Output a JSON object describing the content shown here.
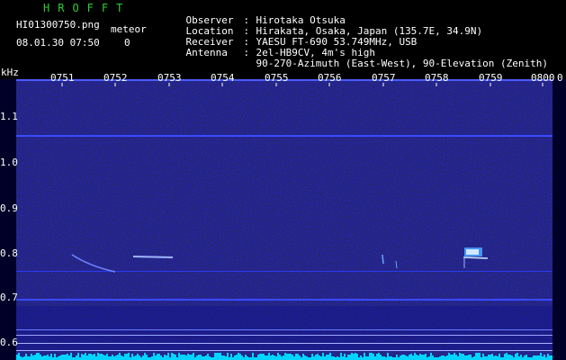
{
  "header": {
    "brand": "HROFFT",
    "filename": "HI01300750.png",
    "meteor_label": "meteor",
    "datetime": "08.01.30 07:50",
    "meteor_count": "0",
    "info": [
      {
        "key": "Observer",
        "value": "Hirotaka Otsuka"
      },
      {
        "key": "Location",
        "value": "Hirakata, Osaka, Japan (135.7E, 34.9N)"
      },
      {
        "key": "Receiver",
        "value": "YAESU FT-690 53.749MHz, USB"
      },
      {
        "key": "Antenna",
        "value": "2el-HB9CV, 4m's high"
      },
      {
        "key": "",
        "value": "90-270-Azimuth (East-West), 90-Elevation (Zenith)"
      }
    ]
  },
  "spectrogram": {
    "y_unit": "kHz",
    "y_ticks": [
      "1.1",
      "1.0",
      "0.9",
      "0.8",
      "0.7",
      "0.6"
    ],
    "x_ticks": [
      "0751",
      "0752",
      "0753",
      "0754",
      "0755",
      "0756",
      "0757",
      "0758",
      "0759",
      "0800"
    ],
    "x_end_label": "0"
  },
  "colors": {
    "brand": "#33cc33",
    "text": "#ffffff",
    "background": "#000000",
    "noise_dark": "#000033",
    "noise_mid": "#0a0a7a",
    "line": "#3a4aff",
    "echo": "#cfe8ff",
    "floor": "#00d4ff"
  }
}
